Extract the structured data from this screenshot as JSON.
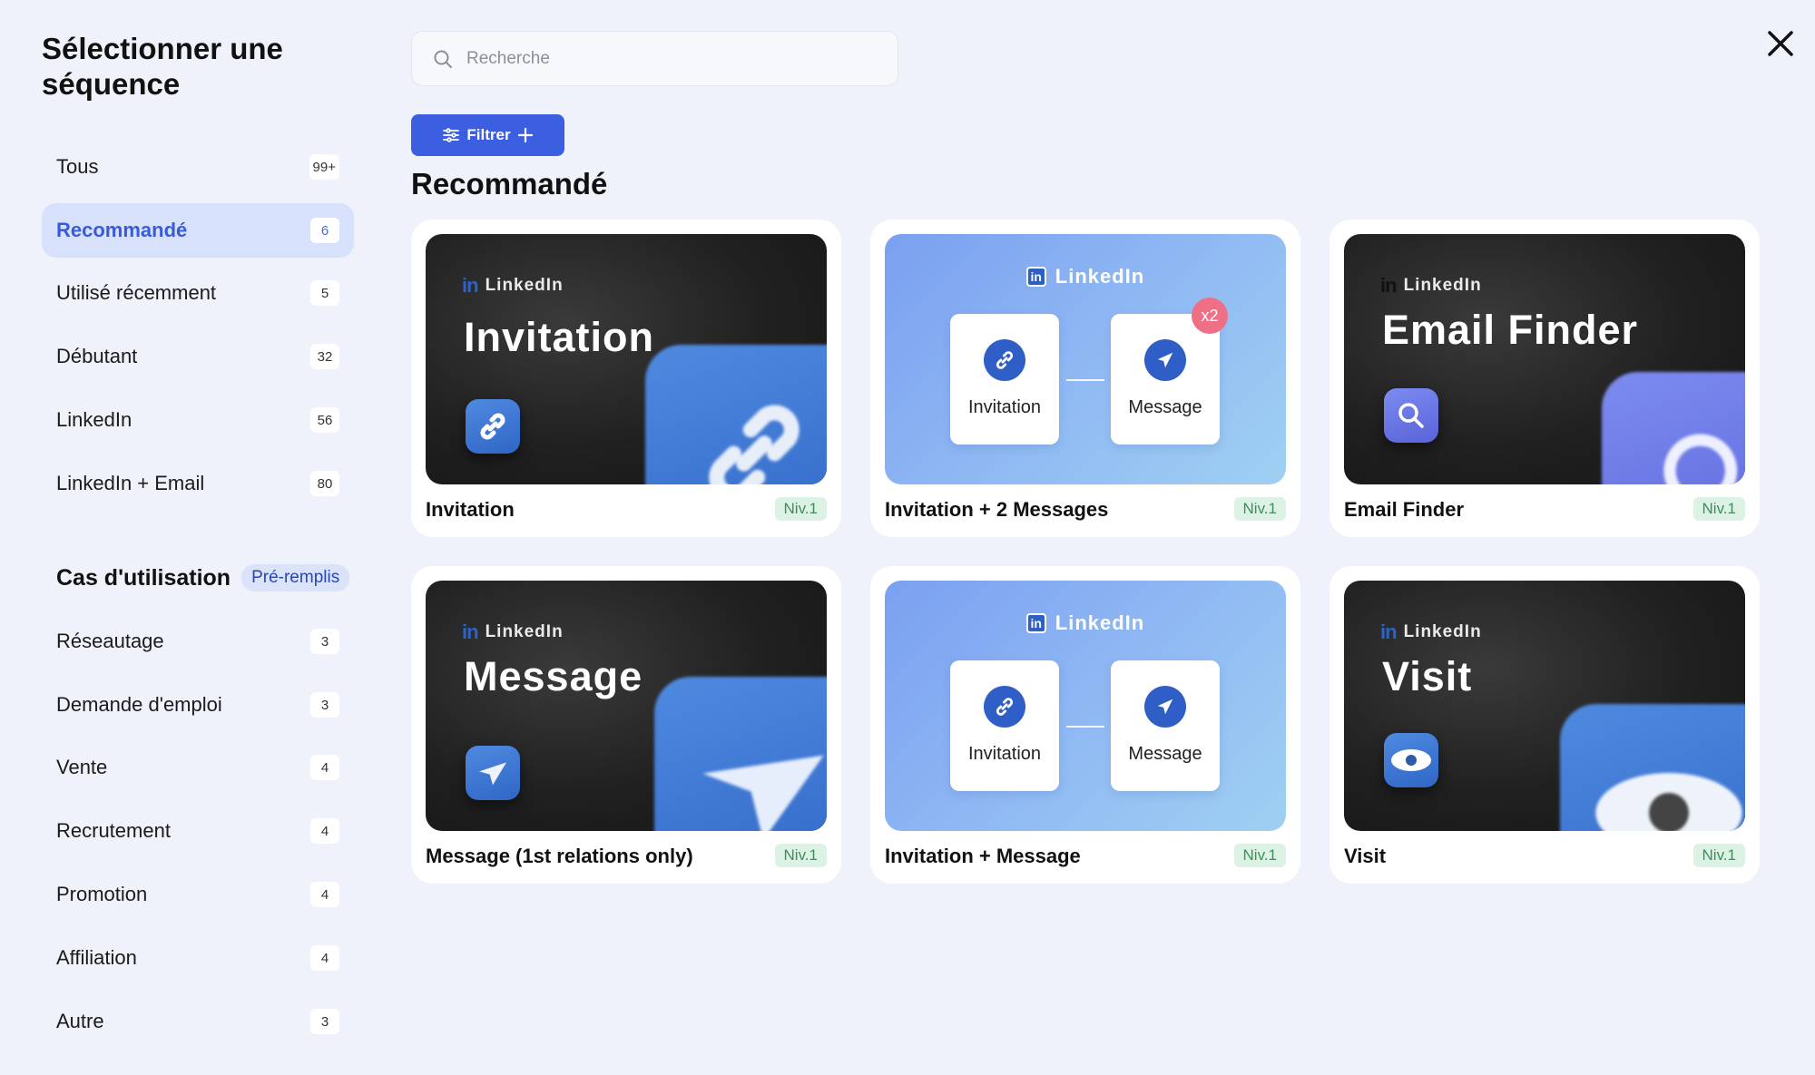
{
  "sidebar": {
    "title": "Sélectionner une séquence",
    "items": [
      {
        "label": "Tous",
        "count": "99+"
      },
      {
        "label": "Recommandé",
        "count": "6"
      },
      {
        "label": "Utilisé récemment",
        "count": "5"
      },
      {
        "label": "Débutant",
        "count": "32"
      },
      {
        "label": "LinkedIn",
        "count": "56"
      },
      {
        "label": "LinkedIn + Email",
        "count": "80"
      }
    ],
    "usecase_title": "Cas d'utilisation",
    "usecase_badge": "Pré-remplis",
    "usecases": [
      {
        "label": "Réseautage",
        "count": "3"
      },
      {
        "label": "Demande d'emploi",
        "count": "3"
      },
      {
        "label": "Vente",
        "count": "4"
      },
      {
        "label": "Recrutement",
        "count": "4"
      },
      {
        "label": "Promotion",
        "count": "4"
      },
      {
        "label": "Affiliation",
        "count": "4"
      },
      {
        "label": "Autre",
        "count": "3"
      }
    ]
  },
  "search": {
    "placeholder": "Recherche"
  },
  "filter": {
    "label": "Filtrer"
  },
  "section_title": "Recommandé",
  "cards": [
    {
      "name": "Invitation",
      "level": "Niv.1",
      "brand": "LinkedIn",
      "thumb_title": "Invitation"
    },
    {
      "name": "Invitation + 2 Messages",
      "level": "Niv.1",
      "brand": "LinkedIn",
      "step1": "Invitation",
      "step2": "Message",
      "multiplier": "x2"
    },
    {
      "name": "Email Finder",
      "level": "Niv.1",
      "brand": "LinkedIn",
      "thumb_title": "Email Finder"
    },
    {
      "name": "Message (1st relations only)",
      "level": "Niv.1",
      "brand": "LinkedIn",
      "thumb_title": "Message"
    },
    {
      "name": "Invitation + Message",
      "level": "Niv.1",
      "brand": "LinkedIn",
      "step1": "Invitation",
      "step2": "Message"
    },
    {
      "name": "Visit",
      "level": "Niv.1",
      "brand": "LinkedIn",
      "thumb_title": "Visit"
    }
  ],
  "colors": {
    "accent": "#3b5fe0",
    "active_bg": "#d7e1fb",
    "level_bg": "#dcf2e4",
    "level_text": "#3e8f5a"
  }
}
